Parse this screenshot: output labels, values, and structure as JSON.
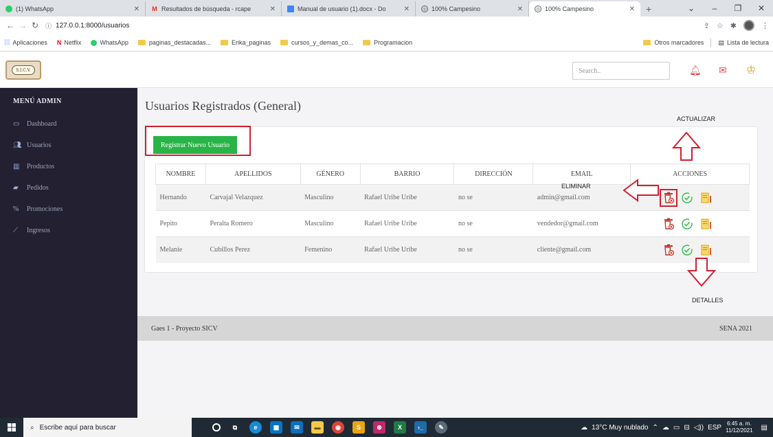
{
  "browser": {
    "tabs": [
      {
        "label": "(1) WhatsApp",
        "color": "#25d366"
      },
      {
        "label": "Resultados de búsqueda - rcape",
        "color": "#ffffff"
      },
      {
        "label": "Manual de usuario (1).docx - Do",
        "color": "#4285f4"
      },
      {
        "label": "100% Campesino",
        "color": "#5f6368"
      },
      {
        "label": "100% Campesino",
        "color": "#5f6368"
      }
    ],
    "url": "127.0.0.1:8000/usuarios",
    "bookmarks": [
      "Aplicaciones",
      "Netflix",
      "WhatsApp",
      "paginas_destacadas...",
      "Erika_paginas",
      "cursos_y_demas_co...",
      "Programacion"
    ],
    "bookmarks_right": [
      "Otros marcadores",
      "Lista de lectura"
    ]
  },
  "header": {
    "logo_text": "S.I.C.V.",
    "search_placeholder": "Search.."
  },
  "sidebar": {
    "title": "MENÚ ADMIN",
    "items": [
      {
        "label": "Dashboard",
        "icon": "monitor-icon"
      },
      {
        "label": "Usuarios",
        "icon": "users-icon"
      },
      {
        "label": "Productos",
        "icon": "chart-icon"
      },
      {
        "label": "Pedidos",
        "icon": "folder-icon"
      },
      {
        "label": "Promociones",
        "icon": "percent-icon"
      },
      {
        "label": "Ingresos",
        "icon": "line-chart-icon"
      }
    ]
  },
  "main": {
    "title": "Usuarios Registrados (General)",
    "register_button": "Registrar Nuevo Usuario",
    "columns": [
      "NOMBRE",
      "APELLIDOS",
      "GÉNERO",
      "BARRIO",
      "DIRECCIÓN",
      "EMAIL",
      "ACCIONES"
    ],
    "rows": [
      [
        "Hernando",
        "Carvajal Velazquez",
        "Masculino",
        "Rafael Uribe Uribe",
        "no se",
        "admin@gmail.com"
      ],
      [
        "Pepito",
        "Peralta Romero",
        "Masculino",
        "Rafael Uribe Uribe",
        "no se",
        "vendedor@gmail.com"
      ],
      [
        "Melanie",
        "Cubillos Perez",
        "Femenino",
        "Rafael Uribe Uribe",
        "no se",
        "cliente@gmail.com"
      ]
    ]
  },
  "annotations": {
    "update": "ACTUALIZAR",
    "delete": "ELIMINAR",
    "details": "DETALLES"
  },
  "footer": {
    "left": "Gaes 1 - Proyecto SICV",
    "right": "SENA 2021"
  },
  "taskbar": {
    "search": "Escribe aquí para buscar",
    "weather": "13°C Muy nublado",
    "lang": "ESP",
    "time": "6:45 a. m.",
    "date": "11/12/2021"
  },
  "colors": {
    "accent_green": "#28b446",
    "annotation_red": "#d11e2e",
    "sidebar_bg": "#232032"
  }
}
